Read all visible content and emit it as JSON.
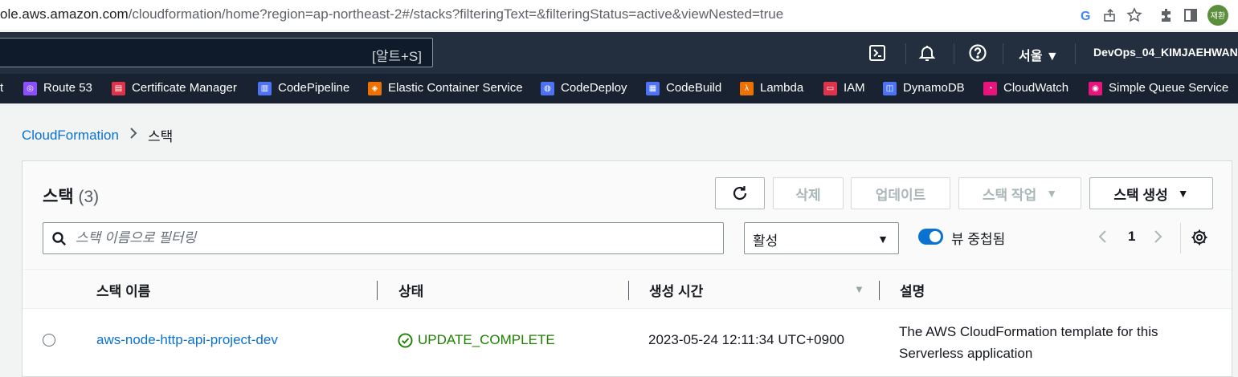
{
  "browser": {
    "url_host": "ole.aws.amazon.com",
    "url_path": "/cloudformation/home?region=ap-northeast-2#/stacks?filteringText=&filteringStatus=active&viewNested=true",
    "avatar_text": "재환"
  },
  "topnav": {
    "search_shortcut": "[알트+S]",
    "region": "서울 ▼",
    "user": "DevOps_04_KIMJAEHWAN"
  },
  "favorites": [
    {
      "label": "t",
      "color": "",
      "icon": ""
    },
    {
      "label": "Route 53",
      "color": "#8c4fff",
      "icon": "route53-icon"
    },
    {
      "label": "Certificate Manager",
      "color": "#dd344c",
      "icon": "certificate-manager-icon"
    },
    {
      "label": "CodePipeline",
      "color": "#4d72f3",
      "icon": "codepipeline-icon"
    },
    {
      "label": "Elastic Container Service",
      "color": "#ed7100",
      "icon": "ecs-icon"
    },
    {
      "label": "CodeDeploy",
      "color": "#4d72f3",
      "icon": "codedeploy-icon"
    },
    {
      "label": "CodeBuild",
      "color": "#4d72f3",
      "icon": "codebuild-icon"
    },
    {
      "label": "Lambda",
      "color": "#ed7100",
      "icon": "lambda-icon"
    },
    {
      "label": "IAM",
      "color": "#dd344c",
      "icon": "iam-icon"
    },
    {
      "label": "DynamoDB",
      "color": "#4d72f3",
      "icon": "dynamodb-icon"
    },
    {
      "label": "CloudWatch",
      "color": "#e7157b",
      "icon": "cloudwatch-icon"
    },
    {
      "label": "Simple Queue Service",
      "color": "#e7157b",
      "icon": "sqs-icon"
    }
  ],
  "breadcrumb": {
    "parent": "CloudFormation",
    "current": "스택"
  },
  "panel": {
    "title": "스택",
    "count": "(3)",
    "buttons": {
      "delete": "삭제",
      "update": "업데이트",
      "stack_actions": "스택 작업",
      "create_stack": "스택 생성"
    },
    "filter_placeholder": "스택 이름으로 필터링",
    "status_select": "활성",
    "toggle_label": "뷰 중첩됨",
    "page": "1"
  },
  "table": {
    "columns": [
      "스택 이름",
      "상태",
      "생성 시간",
      "설명"
    ],
    "rows": [
      {
        "name": "aws-node-http-api-project-dev",
        "status": "UPDATE_COMPLETE",
        "created": "2023-05-24 12:11:34 UTC+0900",
        "description_line1": "The AWS CloudFormation template for this",
        "description_line2": "Serverless application"
      }
    ]
  },
  "colors": {
    "nav_bg": "#232f3e",
    "link": "#0972d3",
    "success": "#1d8102"
  }
}
